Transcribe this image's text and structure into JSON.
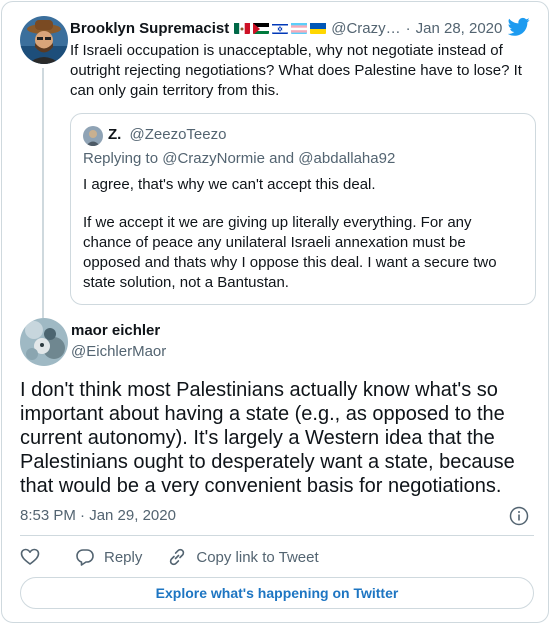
{
  "parent_tweet": {
    "display_name": "Brooklyn Supremacist",
    "flags": [
      "mexico-flag",
      "palestine-flag",
      "israel-flag",
      "transgender-flag",
      "ukraine-flag"
    ],
    "handle": "@Crazy…",
    "separator": "·",
    "date": "Jan 28, 2020",
    "text": "If Israeli occupation is unacceptable, why not negotiate instead of outright rejecting negotiations? What does Palestine have to lose? It can only gain territory from this."
  },
  "quote_tweet": {
    "display_name": "Z.",
    "handle": "@ZeezoTeezo",
    "replying_to": "Replying to @CrazyNormie and @abdallaha92",
    "paragraph_1": "I agree, that's why we can't accept this deal.",
    "paragraph_2": "If we accept it we are giving up literally everything. For any chance of peace any unilateral Israeli annexation must be opposed and thats why I oppose this deal. I want a secure two state solution, not a Bantustan."
  },
  "main_tweet": {
    "display_name": "maor eichler",
    "handle": "@EichlerMaor",
    "text": "I don't think most Palestinians actually know what's so important about having a state (e.g., as opposed to the current autonomy). It's largely a Western idea that the Palestinians ought to desperately want a state, because that would be a very convenient basis for negotiations.",
    "timestamp": "8:53 PM · Jan 29, 2020"
  },
  "actions": {
    "reply_label": "Reply",
    "copy_link_label": "Copy link to Tweet"
  },
  "explore_label": "Explore what's happening on Twitter",
  "colors": {
    "twitter_blue": "#1d9bf0",
    "secondary_text": "#536471",
    "border": "#cfd9de",
    "explore_text": "#1d75c2"
  }
}
